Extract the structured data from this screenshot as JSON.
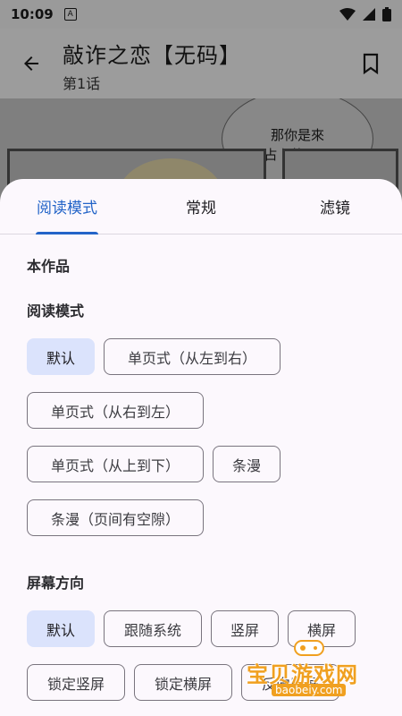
{
  "status_bar": {
    "time": "10:09",
    "notif_letter": "A"
  },
  "app_bar": {
    "title": "敲诈之恋【无码】",
    "subtitle": "第1话"
  },
  "comic": {
    "bubble_line1": "那你是來",
    "bubble_line2": "占卜的吧？"
  },
  "tabs": [
    {
      "label": "阅读模式",
      "active": true
    },
    {
      "label": "常规",
      "active": false
    },
    {
      "label": "滤镜",
      "active": false
    }
  ],
  "sheet": {
    "scope_label": "本作品",
    "reading_mode_label": "阅读模式",
    "reading_modes": [
      "默认",
      "单页式（从左到右）",
      "单页式（从右到左）",
      "单页式（从上到下）",
      "条漫",
      "条漫（页间有空隙）"
    ],
    "orientation_label": "屏幕方向",
    "orientations": [
      "默认",
      "跟随系统",
      "竖屏",
      "横屏",
      "锁定竖屏",
      "锁定横屏",
      "反向竖屏"
    ]
  },
  "watermark": {
    "title": "宝贝游戏网",
    "url": "baobeiy.com"
  },
  "colors": {
    "accent": "#2364c8",
    "selected_chip": "#dbe3fc",
    "watermark": "#f0a020"
  }
}
